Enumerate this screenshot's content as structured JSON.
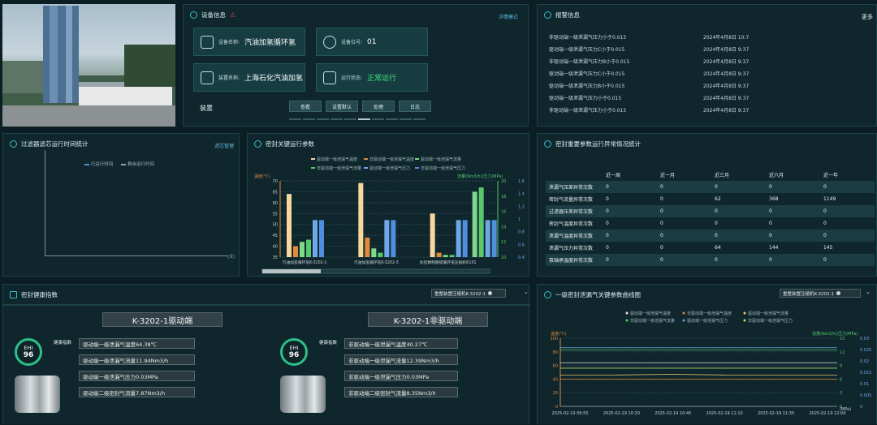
{
  "device": {
    "title": "设备信息",
    "detail_link": "详情模式",
    "name_label": "设备名称:",
    "name_value": "汽油加氢循环氢",
    "position_label": "设备位号:",
    "position_value": "01",
    "install_label": "装置名称:",
    "install_value": "上海石化汽油加氢",
    "status_label": "运行状态:",
    "status_value": "正常运行",
    "section_label": "装置",
    "buttons": [
      "查看",
      "设置默认",
      "处理",
      "日志"
    ]
  },
  "alarm": {
    "title": "报警信息",
    "more": "更多",
    "rows": [
      {
        "text": "非驱动端一级泄漏气压力小于0.015",
        "date": "2024年4月8日 10:7"
      },
      {
        "text": "驱动端一级泄漏气压力C小于0.015",
        "date": "2024年4月8日 9:37"
      },
      {
        "text": "非驱动端一级泄漏气压力B小于0.015",
        "date": "2024年4月8日 9:37"
      },
      {
        "text": "驱动端一级泄漏气压力C小于0.015",
        "date": "2024年4月8日 9:37"
      },
      {
        "text": "驱动端一级泄漏气压力B小于0.015",
        "date": "2024年4月8日 9:37"
      },
      {
        "text": "驱动端一级泄漏气压力小于0.015",
        "date": "2024年4月8日 9:37"
      },
      {
        "text": "非驱动端一级泄漏气压力小于0.015",
        "date": "2024年4月8日 9:37"
      }
    ]
  },
  "filter_panel": {
    "title": "过滤器滤芯运行时间统计",
    "link": "滤芯管理",
    "legend": [
      "已运行时间",
      "剩余运行时间"
    ],
    "x_unit": "(天)"
  },
  "seal_panel": {
    "title": "密封关键运行参数",
    "legend": [
      "驱动端一级泄漏气温度",
      "非驱动端一级泄漏气温度",
      "驱动端一级泄漏气流量",
      "非驱动端一级泄漏气流量",
      "驱动端一级泄漏气压力",
      "非驱动端一级泄漏气压力"
    ]
  },
  "chart_data": [
    {
      "type": "bar",
      "title": "密封关键运行参数",
      "ylabel": "温度(℃)",
      "ylabel_right": "流量(Nm3/h)/压力(MPa)",
      "ylim": [
        35,
        70
      ],
      "ylim_right": [
        0.4,
        1.6
      ],
      "ylim_right2": [
        10,
        20
      ],
      "yticks_left": [
        "70",
        "65",
        "60",
        "55",
        "50",
        "45",
        "40",
        "35"
      ],
      "yticks_right": [
        "1.6",
        "1.4",
        "1.2",
        "1",
        "0.8",
        "0.6",
        "0.4"
      ],
      "yticks_right2": [
        "20",
        "18",
        "16",
        "14",
        "12",
        "10"
      ],
      "categories": [
        "汽油加氢循环氢K-3202-1",
        "汽油加氢循环氢K-3202-3",
        "加氢精制脱硫循环氢压缩机K101"
      ],
      "series": [
        {
          "name": "驱动端一级泄漏气温度",
          "color": "#f6d79c",
          "values": [
            64,
            69,
            55
          ]
        },
        {
          "name": "非驱动端一级泄漏气温度",
          "color": "#e08a3a",
          "values": [
            40,
            44,
            37
          ]
        },
        {
          "name": "驱动端一级泄漏气流量",
          "color": "#7fd98c",
          "values": [
            42,
            39,
            36
          ]
        },
        {
          "name": "非驱动端一级泄漏气流量",
          "color": "#58c86c",
          "values": [
            43,
            37,
            36
          ]
        },
        {
          "name": "驱动端一级泄漏气压力",
          "color": "#6fa8e8",
          "values": [
            52,
            52,
            52
          ]
        },
        {
          "name": "非驱动端一级泄漏气压力",
          "color": "#4f8fe0",
          "values": [
            52,
            52,
            52
          ]
        }
      ],
      "extra_bars": [
        {
          "color": "#7fd98c",
          "value": 65
        },
        {
          "color": "#58c86c",
          "value": 67
        },
        {
          "color": "#6fa8e8",
          "value": 52
        },
        {
          "color": "#4f8fe0",
          "value": 52
        }
      ]
    },
    {
      "type": "line",
      "title": "一级密封泄漏气关键参数曲线图",
      "ylabel": "温度(℃)",
      "ylabel_right": "流量(Nm3/h)/压力(MPa)",
      "ylim": [
        0,
        100
      ],
      "ylim_right": [
        0,
        0.03
      ],
      "yticks_left": [
        "100",
        "80",
        "60",
        "40",
        "20",
        "0"
      ],
      "yticks_right": [
        "15",
        "12",
        "9",
        "6",
        "3",
        "0"
      ],
      "yticks_right2": [
        "0.03",
        "0.025",
        "0.02",
        "0.015",
        "0.01",
        "0.005",
        "0"
      ],
      "x": [
        "2025-02-19 09:55",
        "2025-02-19 10:20",
        "2025-02-19 10:45",
        "2025-02-19 11:10",
        "2025-02-19 11:35",
        "2025-02-19 12:00"
      ],
      "series": [
        {
          "name": "驱动端一级泄漏气温度",
          "color": "#e6e6e6",
          "values": [
            64,
            64,
            64,
            64,
            64,
            64
          ]
        },
        {
          "name": "非驱动端一级泄漏气温度",
          "color": "#e08a3a",
          "values": [
            40,
            40,
            40,
            40,
            40,
            40
          ]
        },
        {
          "name": "驱动端一级泄漏气流量",
          "color": "#e8c36a",
          "values": [
            46,
            46,
            47,
            46,
            46,
            46
          ]
        },
        {
          "name": "非驱动端一级泄漏气流量",
          "color": "#58c86c",
          "values": [
            83,
            83,
            83,
            83,
            83,
            83
          ]
        },
        {
          "name": "驱动端一级泄漏气压力",
          "color": "#6fa8e8",
          "values": [
            86,
            86,
            86,
            86,
            86,
            86
          ]
        },
        {
          "name": "非驱动端一级泄漏气压力",
          "color": "#b0e070",
          "values": [
            56,
            56,
            56,
            56,
            56,
            56
          ]
        }
      ]
    }
  ],
  "abn_panel": {
    "title": "密封重要参数运行异常情况统计",
    "columns": [
      "",
      "近一周",
      "近一月",
      "近三月",
      "近六月",
      "近一年"
    ],
    "rows": [
      [
        "泄漏气压差异常次数",
        "0",
        "0",
        "0",
        "0",
        "0"
      ],
      [
        "密封气流量异常次数",
        "0",
        "0",
        "62",
        "368",
        "1149"
      ],
      [
        "过滤器压差异常次数",
        "0",
        "0",
        "0",
        "0",
        "0"
      ],
      [
        "密封气温度异常次数",
        "0",
        "0",
        "0",
        "0",
        "0"
      ],
      [
        "泄漏气温度异常次数",
        "0",
        "0",
        "0",
        "0",
        "0"
      ],
      [
        "泄漏气压力异常次数",
        "0",
        "0",
        "64",
        "144",
        "145"
      ],
      [
        "泵轴承温度异常次数",
        "0",
        "0",
        "0",
        "0",
        "0"
      ]
    ]
  },
  "health": {
    "title": "密封健康指数",
    "select": "重整装置压缩机K-3202-1",
    "units": [
      {
        "name": "K-3202-1驱动端",
        "ehi_label": "EHI",
        "ehi": "96",
        "index_label": "健康指数",
        "metrics": [
          "驱动端一级泄漏气温度64.38℃",
          "驱动端一级泄漏气流量11.94Nm3/h",
          "驱动端一级泄漏气压力0.03MPa",
          "驱动端二级密封气流量7.87Nm3/h"
        ]
      },
      {
        "name": "K-3202-1非驱动端",
        "ehi_label": "EHI",
        "ehi": "96",
        "index_label": "健康指数",
        "metrics": [
          "非驱动端一级泄漏气温度40.27℃",
          "非驱动端一级泄漏气流量12.39Nm3/h",
          "非驱动端一级泄漏气压力0.03MPa",
          "非驱动端二级密封气流量8.35Nm3/h"
        ]
      }
    ]
  },
  "curve": {
    "title": "一级密封泄漏气关键参数曲线图",
    "select": "重整装置压缩机K-3202-1",
    "right_unit": "(MPa)"
  }
}
